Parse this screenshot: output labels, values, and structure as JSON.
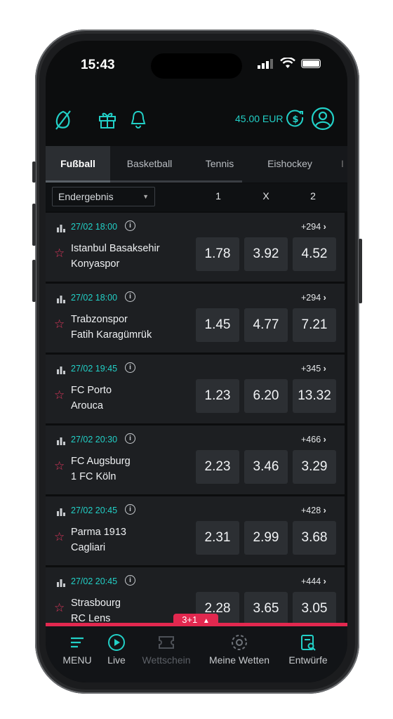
{
  "status_bar": {
    "time": "15:43"
  },
  "header": {
    "balance": "45.00 EUR"
  },
  "tabs": [
    {
      "label": "Fußball",
      "active": true
    },
    {
      "label": "Basketball"
    },
    {
      "label": "Tennis"
    },
    {
      "label": "Eishockey"
    }
  ],
  "market": {
    "selected": "Endergebnis",
    "columns": [
      "1",
      "X",
      "2"
    ]
  },
  "matches": [
    {
      "date": "27/02 18:00",
      "more": "+294",
      "home": "Istanbul Basaksehir",
      "away": "Konyaspor",
      "odds": [
        "1.78",
        "3.92",
        "4.52"
      ]
    },
    {
      "date": "27/02 18:00",
      "more": "+294",
      "home": "Trabzonspor",
      "away": "Fatih Karagümrük",
      "odds": [
        "1.45",
        "4.77",
        "7.21"
      ]
    },
    {
      "date": "27/02 19:45",
      "more": "+345",
      "home": "FC Porto",
      "away": "Arouca",
      "odds": [
        "1.23",
        "6.20",
        "13.32"
      ]
    },
    {
      "date": "27/02 20:30",
      "more": "+466",
      "home": "FC Augsburg",
      "away": "1 FC Köln",
      "odds": [
        "2.23",
        "3.46",
        "3.29"
      ]
    },
    {
      "date": "27/02 20:45",
      "more": "+428",
      "home": "Parma 1913",
      "away": "Cagliari",
      "odds": [
        "2.31",
        "2.99",
        "3.68"
      ]
    },
    {
      "date": "27/02 20:45",
      "more": "+444",
      "home": "Strasbourg",
      "away": "RC Lens",
      "odds": [
        "2.28",
        "3.65",
        "3.05"
      ]
    }
  ],
  "betslip": {
    "label": "3+1"
  },
  "bottom_nav": [
    {
      "label": "MENU",
      "icon": "menu-icon"
    },
    {
      "label": "Live",
      "icon": "live-icon"
    },
    {
      "label": "Wettschein",
      "icon": "ticket-icon"
    },
    {
      "label": "Meine Wetten",
      "icon": "my-bets-icon"
    },
    {
      "label": "Entwürfe",
      "icon": "drafts-icon"
    }
  ],
  "colors": {
    "accent": "#22d0c7",
    "danger": "#e2284f",
    "card": "#1d1f22"
  }
}
